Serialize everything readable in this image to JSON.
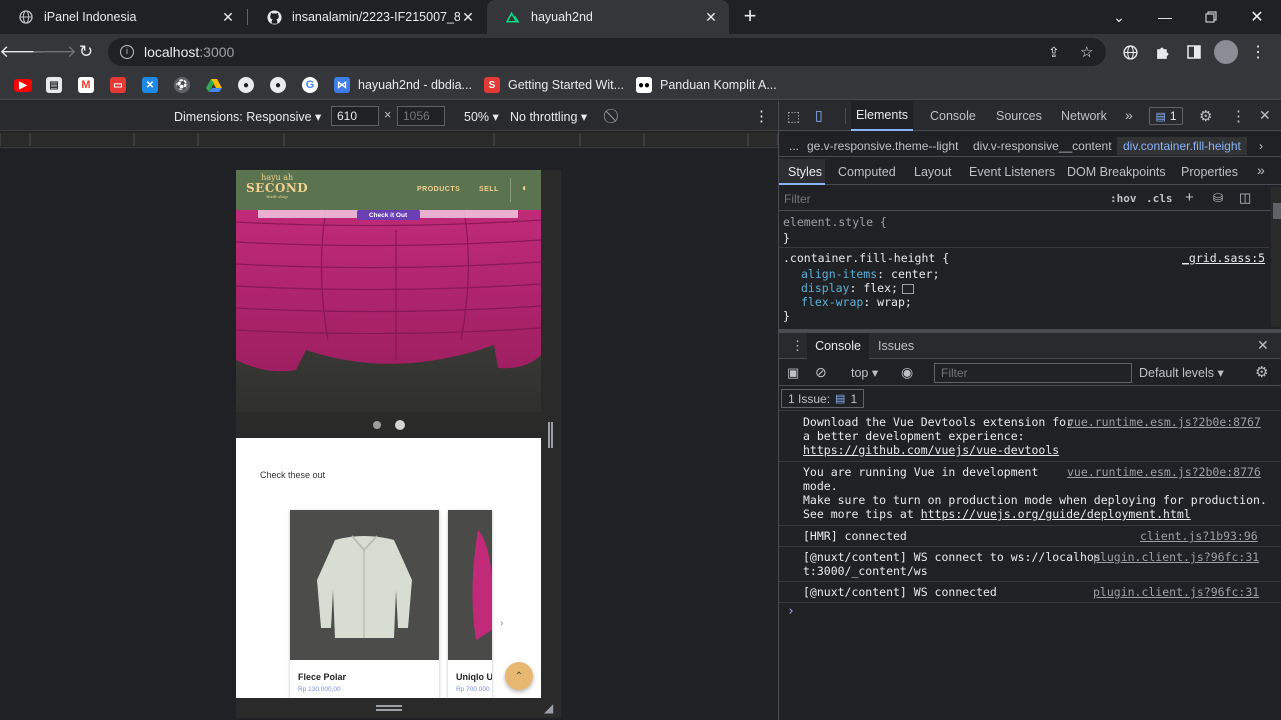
{
  "browser": {
    "tabs": [
      {
        "title": "iPanel Indonesia",
        "icon": "globe-icon",
        "active": false
      },
      {
        "title": "insanalamin/2223-IF215007_8-pe",
        "icon": "github-icon",
        "active": false
      },
      {
        "title": "hayuah2nd",
        "icon": "nuxt-icon",
        "active": true
      }
    ],
    "new_tab": "+",
    "url_host": "localhost",
    "url_port": ":3000",
    "bookmarks": [
      {
        "label": "",
        "icon": "youtube-icon",
        "color": "#ff0000"
      },
      {
        "label": "",
        "icon": "bookmark-app-icon",
        "color": "#e8eaed"
      },
      {
        "label": "",
        "icon": "gmail-icon",
        "color": "#ea4335"
      },
      {
        "label": "",
        "icon": "oracle-icon",
        "color": "#e53935"
      },
      {
        "label": "",
        "icon": "x-app-icon",
        "color": "#1e88e5"
      },
      {
        "label": "",
        "icon": "ball-icon",
        "color": "#5f6368"
      },
      {
        "label": "",
        "icon": "drive-icon",
        "color": "#34a853"
      },
      {
        "label": "",
        "icon": "github-icon",
        "color": "#e8eaed"
      },
      {
        "label": "",
        "icon": "github-icon",
        "color": "#e8eaed"
      },
      {
        "label": "",
        "icon": "google-icon",
        "color": "#4285f4"
      },
      {
        "label": "hayuah2nd - dbdia...",
        "icon": "dbdiagram-icon",
        "color": "#3f7ce6"
      },
      {
        "label": "Getting Started Wit...",
        "icon": "scribd-icon",
        "color": "#e53935"
      },
      {
        "label": "Panduan Komplit A...",
        "icon": "medium-icon",
        "color": "#ffffff"
      }
    ]
  },
  "devtoolbar": {
    "dimensions_label": "Dimensions: Responsive",
    "width_value": "610",
    "height_placeholder": "1056",
    "times": "×",
    "zoom": "50%",
    "throttling": "No throttling"
  },
  "site": {
    "brand_top": "hayu ah",
    "brand_main": "SECOND",
    "brand_sub": "thrift shop",
    "nav": [
      "PRODUCTS",
      "SELL"
    ],
    "hero_button": "Check it Out",
    "section_title": "Check these out",
    "products": [
      {
        "name": "Flece Polar",
        "price": "Rp 130.000,00"
      },
      {
        "name": "Uniqlo U",
        "price": "Rp 700.000"
      }
    ],
    "colors": {
      "header": "#5c7350",
      "accent": "#6a3fb5",
      "price": "#7b8fd6",
      "fab": "#e6b872"
    }
  },
  "devtools": {
    "tabs": [
      "Elements",
      "Console",
      "Sources",
      "Network"
    ],
    "issue_count": "1",
    "breadcrumb": [
      "...",
      "ge.v-responsive.theme--light",
      "div.v-responsive__content",
      "div.container.fill-height"
    ],
    "styles_tabs": [
      "Styles",
      "Computed",
      "Layout",
      "Event Listeners",
      "DOM Breakpoints",
      "Properties"
    ],
    "filter_placeholder": "Filter",
    "hov": ":hov",
    "cls": ".cls",
    "element_style": "element.style {",
    "close_brace": "}",
    "rule_selector": ".container.fill-height {",
    "rule_source": "_grid.sass:5",
    "declarations": [
      {
        "prop": "align-items",
        "value": "center;"
      },
      {
        "prop": "display",
        "value": "flex;"
      },
      {
        "prop": "flex-wrap",
        "value": "wrap;"
      }
    ],
    "drawer_tabs": [
      "Console",
      "Issues"
    ],
    "context": "top",
    "console_filter": "Filter",
    "levels": "Default levels",
    "issues_label": "1 Issue:",
    "issues_count": "1",
    "messages": [
      {
        "lines": [
          "Download the Vue Devtools extension for",
          "a better development experience:"
        ],
        "link": "https://github.com/vuejs/vue-devtools",
        "source": "vue.runtime.esm.js?2b0e:8767"
      },
      {
        "lines": [
          "You are running Vue in development",
          "mode.",
          "Make sure to turn on production mode when deploying for production."
        ],
        "tail_prefix": "See more tips at ",
        "link": "https://vuejs.org/guide/deployment.html",
        "source": "vue.runtime.esm.js?2b0e:8776"
      },
      {
        "lines": [
          "[HMR] connected"
        ],
        "source": "client.js?1b93:96"
      },
      {
        "lines": [
          "[@nuxt/content] WS connect to ws://localhos",
          "t:3000/_content/ws"
        ],
        "source_lines": [
          "plugin.client.js?96fc:31"
        ]
      },
      {
        "lines": [
          "[@nuxt/content] WS connected"
        ],
        "source": "plugin.client.js?96fc:31"
      }
    ],
    "prompt": "›"
  }
}
